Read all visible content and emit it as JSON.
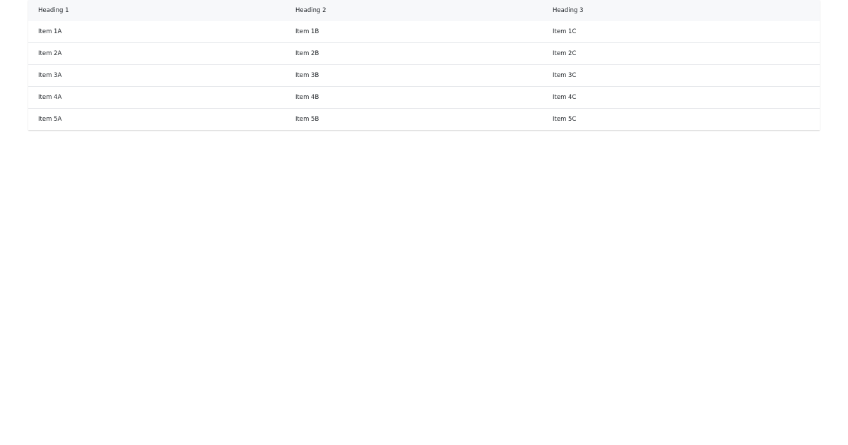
{
  "table": {
    "headers": [
      "Heading 1",
      "Heading 2",
      "Heading 3"
    ],
    "rows": [
      [
        "Item 1A",
        "Item 1B",
        "Item 1C"
      ],
      [
        "Item 2A",
        "Item 2B",
        "Item 2C"
      ],
      [
        "Item 3A",
        "Item 3B",
        "Item 3C"
      ],
      [
        "Item 4A",
        "Item 4B",
        "Item 4C"
      ],
      [
        "Item 5A",
        "Item 5B",
        "Item 5C"
      ]
    ]
  },
  "colors": {
    "header_background": "#f7f8fa",
    "row_divider": "#e6e8eb",
    "text": "#1f2328"
  }
}
